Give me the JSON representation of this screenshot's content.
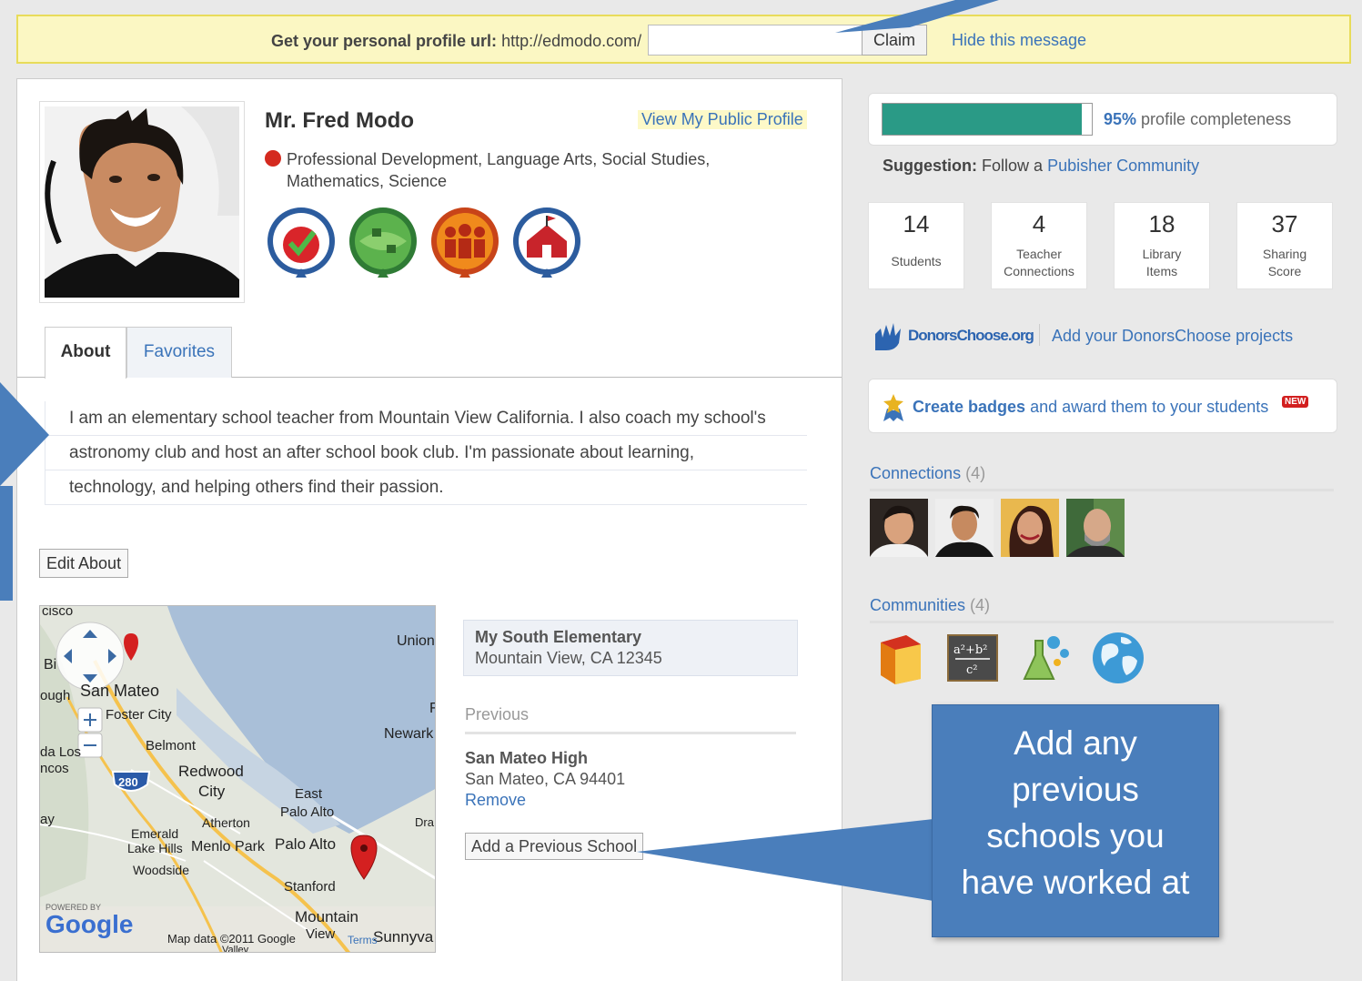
{
  "banner": {
    "label_bold": "Get your personal profile url:",
    "url_prefix": "http://edmodo.com/",
    "input_value": "",
    "claim_label": "Claim",
    "hide_label": "Hide this message"
  },
  "profile": {
    "name": "Mr. Fred Modo",
    "public_profile_label": "View My Public Profile",
    "subjects_line1": "Professional Development, Language Arts, Social Studies,",
    "subjects_line2": "Mathematics, Science",
    "badge_icons": [
      "apple-check-badge-icon",
      "community-map-badge-icon",
      "people-group-badge-icon",
      "school-house-badge-icon"
    ]
  },
  "tabs": [
    {
      "label": "About",
      "active": true
    },
    {
      "label": "Favorites",
      "active": false
    }
  ],
  "about": {
    "lines": [
      "I am an elementary school teacher from Mountain View California. I also coach my school's",
      "astronomy club and host an after school book club. I'm passionate about learning,",
      "technology, and helping others find their passion."
    ],
    "edit_label": "Edit About"
  },
  "map": {
    "labels": [
      "cisco",
      "Union",
      "Bi",
      "ough",
      "San Mateo",
      "Foster City",
      "F",
      "Newark",
      "da Los",
      "ncos",
      "Belmont",
      "280",
      "Redwood",
      "City",
      "East",
      "Palo Alto",
      "ay",
      "Atherton",
      "Dra",
      "Emerald",
      "Lake Hills",
      "Menlo Park",
      "Palo Alto",
      "Woodside",
      "Stanford",
      "Mountain",
      "View",
      "Sunnyva",
      "Map data ©2011 Google",
      "POWERED BY",
      "Google",
      "Terms",
      "Valley"
    ]
  },
  "schools": {
    "current_name": "My South Elementary",
    "current_location": "Mountain View, CA 12345",
    "previous_heading": "Previous",
    "previous_name": "San Mateo High",
    "previous_location": "San Mateo, CA 94401",
    "remove_label": "Remove",
    "add_previous_label": "Add a Previous School"
  },
  "completeness": {
    "percent": 95,
    "percent_text": "95%",
    "label": "profile completeness",
    "fill_color": "#2a9a86"
  },
  "suggestion": {
    "prefix": "Suggestion:",
    "text": "Follow a",
    "link": "Pubisher Community"
  },
  "stats": [
    {
      "value": "14",
      "label_line1": "Students",
      "label_line2": ""
    },
    {
      "value": "4",
      "label_line1": "Teacher",
      "label_line2": "Connections"
    },
    {
      "value": "18",
      "label_line1": "Library",
      "label_line2": "Items"
    },
    {
      "value": "37",
      "label_line1": "Sharing",
      "label_line2": "Score"
    }
  ],
  "donors": {
    "logo_text": "DonorsChoose.org",
    "link": "Add your DonorsChoose projects"
  },
  "create_badges": {
    "bold": "Create badges",
    "rest": "and award them to your students",
    "new_tag": "NEW"
  },
  "connections": {
    "title": "Connections",
    "count": "(4)"
  },
  "communities": {
    "title": "Communities",
    "count": "(4)",
    "icons": [
      "books-icon",
      "math-formula-icon",
      "science-flask-icon",
      "globe-icon"
    ]
  },
  "callout": {
    "line1": "Add any",
    "line2": "previous",
    "line3": "schools you",
    "line4": "have worked at"
  },
  "colors": {
    "link": "#3a73b9",
    "callout": "#4a7ebb",
    "banner_bg": "#fbf7c3"
  }
}
